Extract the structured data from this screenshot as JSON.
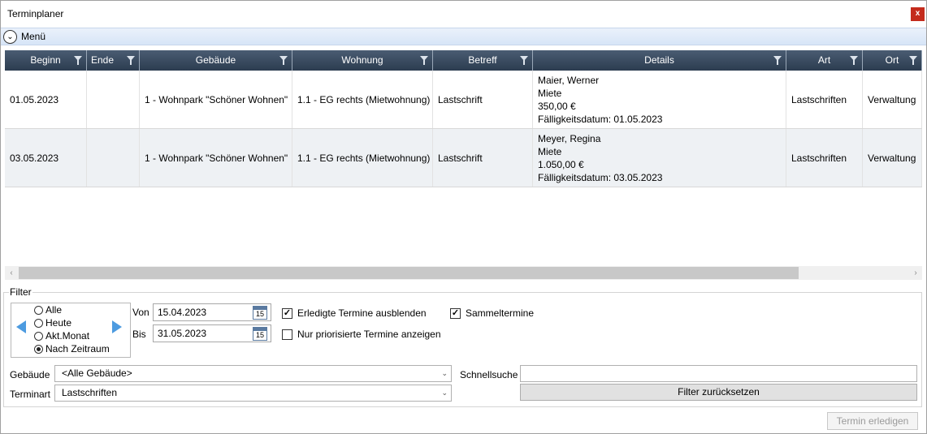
{
  "window": {
    "title": "Terminplaner",
    "close_label": "x"
  },
  "menu": {
    "label": "Menü",
    "icon": "chevron-down-circle-icon"
  },
  "grid": {
    "columns": [
      "Beginn",
      "Ende",
      "Gebäude",
      "Wohnung",
      "Betreff",
      "Details",
      "Art",
      "Ort"
    ],
    "rows": [
      {
        "beginn": "01.05.2023",
        "ende": "",
        "gebaeude": "1 - Wohnpark \"Schöner Wohnen\"",
        "wohnung": "1.1 - EG rechts (Mietwohnung)",
        "betreff": "Lastschrift",
        "details": [
          "Maier, Werner",
          "Miete",
          "350,00 €",
          "Fälligkeitsdatum: 01.05.2023"
        ],
        "art": "Lastschriften",
        "ort": "Verwaltung"
      },
      {
        "beginn": "03.05.2023",
        "ende": "",
        "gebaeude": "1 - Wohnpark \"Schöner Wohnen\"",
        "wohnung": "1.1 - EG rechts (Mietwohnung)",
        "betreff": "Lastschrift",
        "details": [
          "Meyer, Regina",
          "Miete",
          "1.050,00 €",
          "Fälligkeitsdatum: 03.05.2023"
        ],
        "art": "Lastschriften",
        "ort": "Verwaltung"
      }
    ]
  },
  "filter": {
    "title": "Filter",
    "range_options": [
      "Alle",
      "Heute",
      "Akt.Monat",
      "Nach Zeitraum"
    ],
    "selected_range": "Nach Zeitraum",
    "von_label": "Von",
    "von_value": "15.04.2023",
    "bis_label": "Bis",
    "bis_value": "31.05.2023",
    "calendar_day": "15",
    "hide_done_label": "Erledigte Termine ausblenden",
    "hide_done_checked": true,
    "prioritized_label": "Nur priorisierte Termine anzeigen",
    "prioritized_checked": false,
    "collective_label": "Sammeltermine",
    "collective_checked": true,
    "gebaeude_label": "Gebäude",
    "gebaeude_value": "<Alle Gebäude>",
    "terminart_label": "Terminart",
    "terminart_value": "Lastschriften",
    "quicksearch_label": "Schnellsuche",
    "quicksearch_value": "",
    "reset_label": "Filter zurücksetzen"
  },
  "footer": {
    "done_label": "Termin erledigen"
  },
  "colors": {
    "header_bg": "#3a4b60",
    "accent_blue": "#4d9be0",
    "close_red": "#c42b1c"
  }
}
